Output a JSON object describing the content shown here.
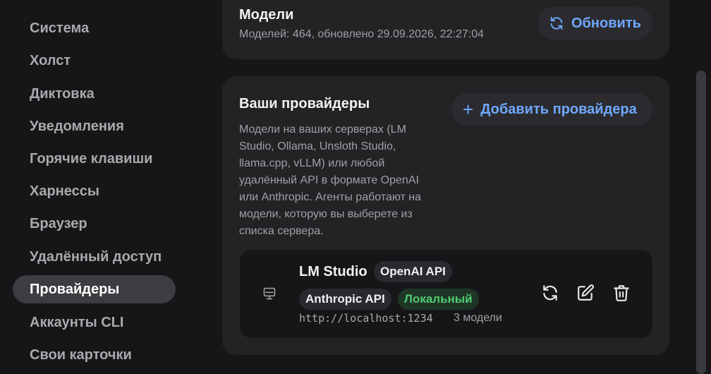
{
  "sidebar": {
    "items": [
      {
        "label": "Система"
      },
      {
        "label": "Холст"
      },
      {
        "label": "Диктовка"
      },
      {
        "label": "Уведомления"
      },
      {
        "label": "Горячие клавиши"
      },
      {
        "label": "Харнессы"
      },
      {
        "label": "Браузер"
      },
      {
        "label": "Удалённый доступ"
      },
      {
        "label": "Провайдеры",
        "active": true
      },
      {
        "label": "Аккаунты CLI"
      },
      {
        "label": "Свои карточки"
      }
    ]
  },
  "models": {
    "title": "Модели",
    "subtitle": "Моделей: 464, обновлено 29.09.2026, 22:27:04",
    "refresh_label": "Обновить"
  },
  "providers": {
    "title": "Ваши провайдеры",
    "description": "Модели на ваших серверах (LM Studio, Ollama, Unsloth Studio, llama.cpp, vLLM) или любой удалённый API в формате OpenAI или Anthropic. Агенты работают на модели, которую вы выберете из списка сервера.",
    "add_label": "Добавить провайдера",
    "add_icon": "+",
    "list": [
      {
        "name": "LM Studio",
        "tags": [
          "OpenAI API",
          "Anthropic API"
        ],
        "status": "Локальный",
        "url": "http://localhost:1234",
        "model_count": "3 модели",
        "icon": "monitor-icon"
      }
    ]
  },
  "colors": {
    "accent": "#6fa8ff",
    "local_green": "#4fca72",
    "card_bg": "#232326",
    "page_bg": "#161618"
  }
}
